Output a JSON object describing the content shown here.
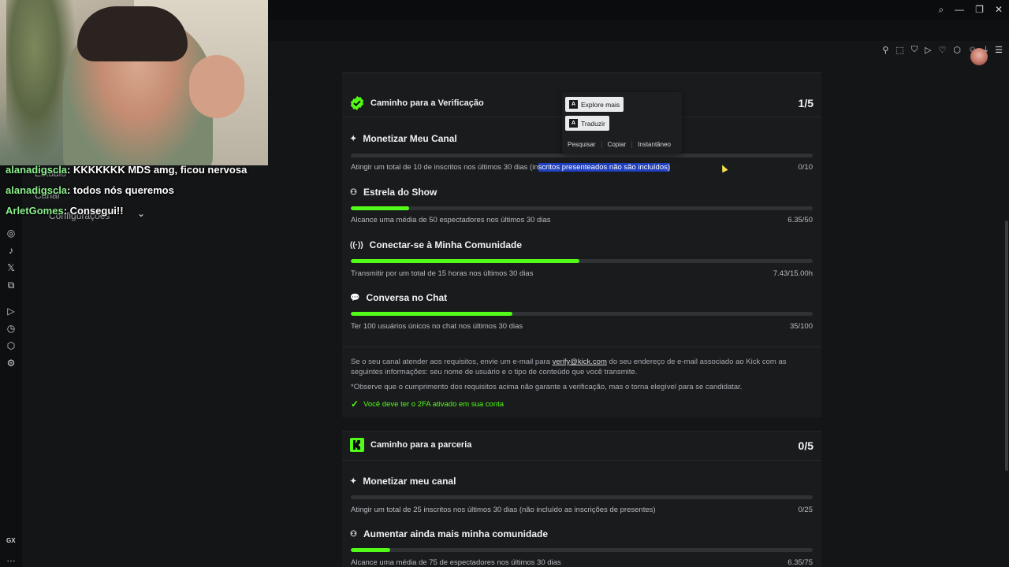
{
  "chat": [
    {
      "user": "alanadigscla",
      "message": ": KKKKKKK MDS amg, ficou nervosa"
    },
    {
      "user": "alanadigscla",
      "message": ": todos nós queremos"
    },
    {
      "user": "ArletGomes",
      "message": ": Consegui!!"
    }
  ],
  "nav_ghost": {
    "item1": "Estúdio",
    "item2": "Canal",
    "item3": "Configurações"
  },
  "context_popup": {
    "explore": "Explore mais",
    "translate": "Traduzir",
    "search": "Pesquisar",
    "copy": "Copiar",
    "instant": "Instantâneo"
  },
  "verification": {
    "title": "Caminho para a Verificação",
    "progress": "1/5",
    "items": [
      {
        "title": "Monetizar Meu Canal",
        "desc_pre": "Atingir um total de 10 de inscritos nos últimos 30 dias (in",
        "desc_hl": "scritos presenteados não são incluídos)",
        "value": "0/10",
        "fill": 0.0
      },
      {
        "title": "Estrela do Show",
        "desc": "Alcance uma média de 50 espectadores nos últimos 30 dias",
        "value": "6.35/50",
        "fill": 0.127
      },
      {
        "title": "Conectar-se à Minha Comunidade",
        "desc": "Transmitir por um total de 15 horas nos últimos 30 dias",
        "value": "7.43/15.00h",
        "fill": 0.495
      },
      {
        "title": "Conversa no Chat",
        "desc": "Ter 100 usuários únicos no chat nos últimos 30 dias",
        "value": "35/100",
        "fill": 0.35
      }
    ],
    "note_pre": "Se o seu canal atender aos requisitos, envie um e-mail para ",
    "note_email": "verify@kick.com",
    "note_post": " do seu endereço de e-mail associado ao Kick com as seguintes informações: seu nome de usuário e o tipo de conteúdo que você transmite.",
    "disclaimer": "*Observe que o cumprimento dos requisitos acima não garante a verificação, mas o torna elegível para se candidatar.",
    "twofa": "Você deve ter o 2FA ativado em sua conta"
  },
  "partnership": {
    "title": "Caminho para a parceria",
    "progress": "0/5",
    "items": [
      {
        "title": "Monetizar meu canal",
        "desc": "Atingir um total de 25 inscritos nos últimos 30 dias (não incluído as inscrições de presentes)",
        "value": "0/25",
        "fill": 0.0
      },
      {
        "title": "Aumentar ainda mais minha comunidade",
        "desc": "Alcance uma média de 75 de espectadores nos últimos 30 dias",
        "value": "6.35/75",
        "fill": 0.085
      }
    ]
  },
  "sidebar_footer": "GX",
  "colors": {
    "accent": "#53fc18",
    "bg": "#141517",
    "panel": "#191b1d"
  }
}
